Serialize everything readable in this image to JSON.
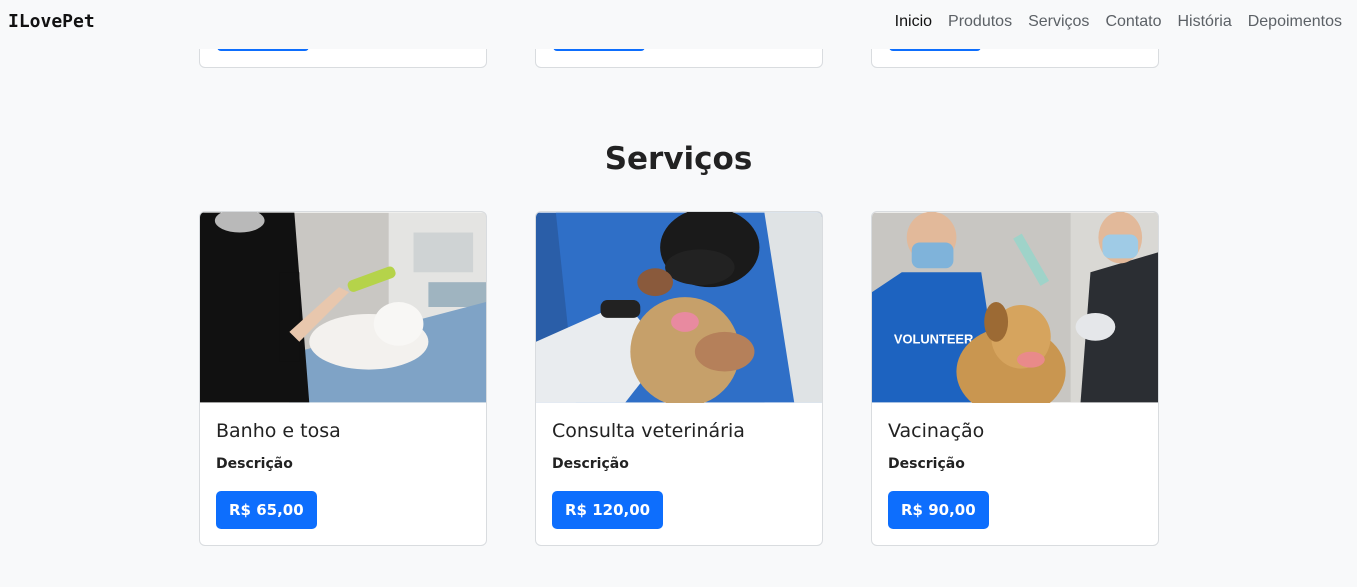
{
  "navbar": {
    "brand": "ILovePet",
    "links": [
      {
        "label": "Inicio",
        "active": true
      },
      {
        "label": "Produtos"
      },
      {
        "label": "Serviços"
      },
      {
        "label": "Contato"
      },
      {
        "label": "História"
      },
      {
        "label": "Depoimentos"
      }
    ]
  },
  "services": {
    "title": "Serviços",
    "cards": [
      {
        "title": "Banho e tosa",
        "description": "Descrição",
        "price": "R$ 65,00",
        "image": "cat-grooming-photo"
      },
      {
        "title": "Consulta veterinária",
        "description": "Descrição",
        "price": "R$ 120,00",
        "image": "vet-checkup-photo"
      },
      {
        "title": "Vacinação",
        "description": "Descrição",
        "price": "R$ 90,00",
        "image": "dog-vaccination-photo"
      }
    ]
  },
  "colors": {
    "primary": "#0d6efd",
    "background": "#f8f9fa"
  }
}
